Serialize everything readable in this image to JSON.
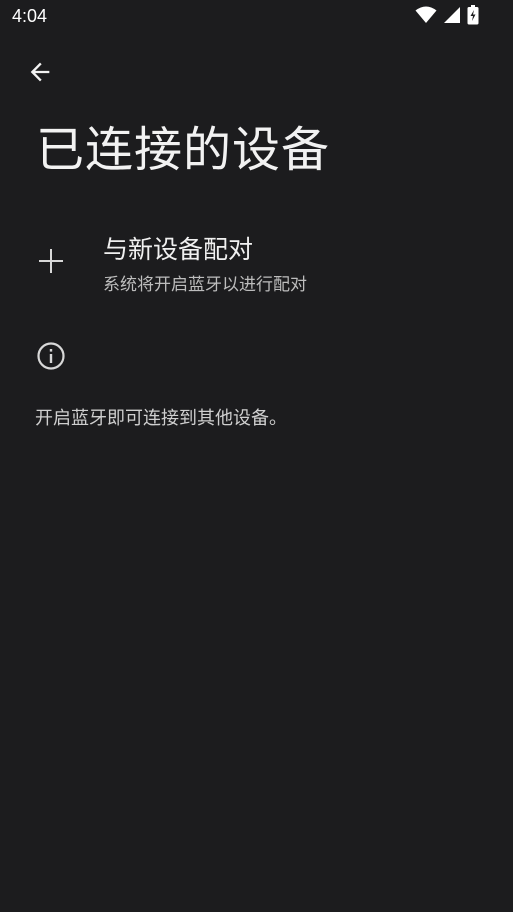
{
  "status_bar": {
    "time": "4:04",
    "icons": [
      "wifi-icon",
      "cellular-signal-icon",
      "battery-charging-icon"
    ]
  },
  "header": {
    "back_icon": "arrow-back-icon",
    "title": "已连接的设备"
  },
  "pair_new_device": {
    "icon": "plus-icon",
    "title": "与新设备配对",
    "subtitle": "系统将开启蓝牙以进行配对"
  },
  "info": {
    "icon": "info-icon",
    "text": "开启蓝牙即可连接到其他设备。"
  },
  "colors": {
    "background": "#1c1c1e",
    "text_primary": "#f0f0f0",
    "text_secondary": "#bdbdbd"
  }
}
